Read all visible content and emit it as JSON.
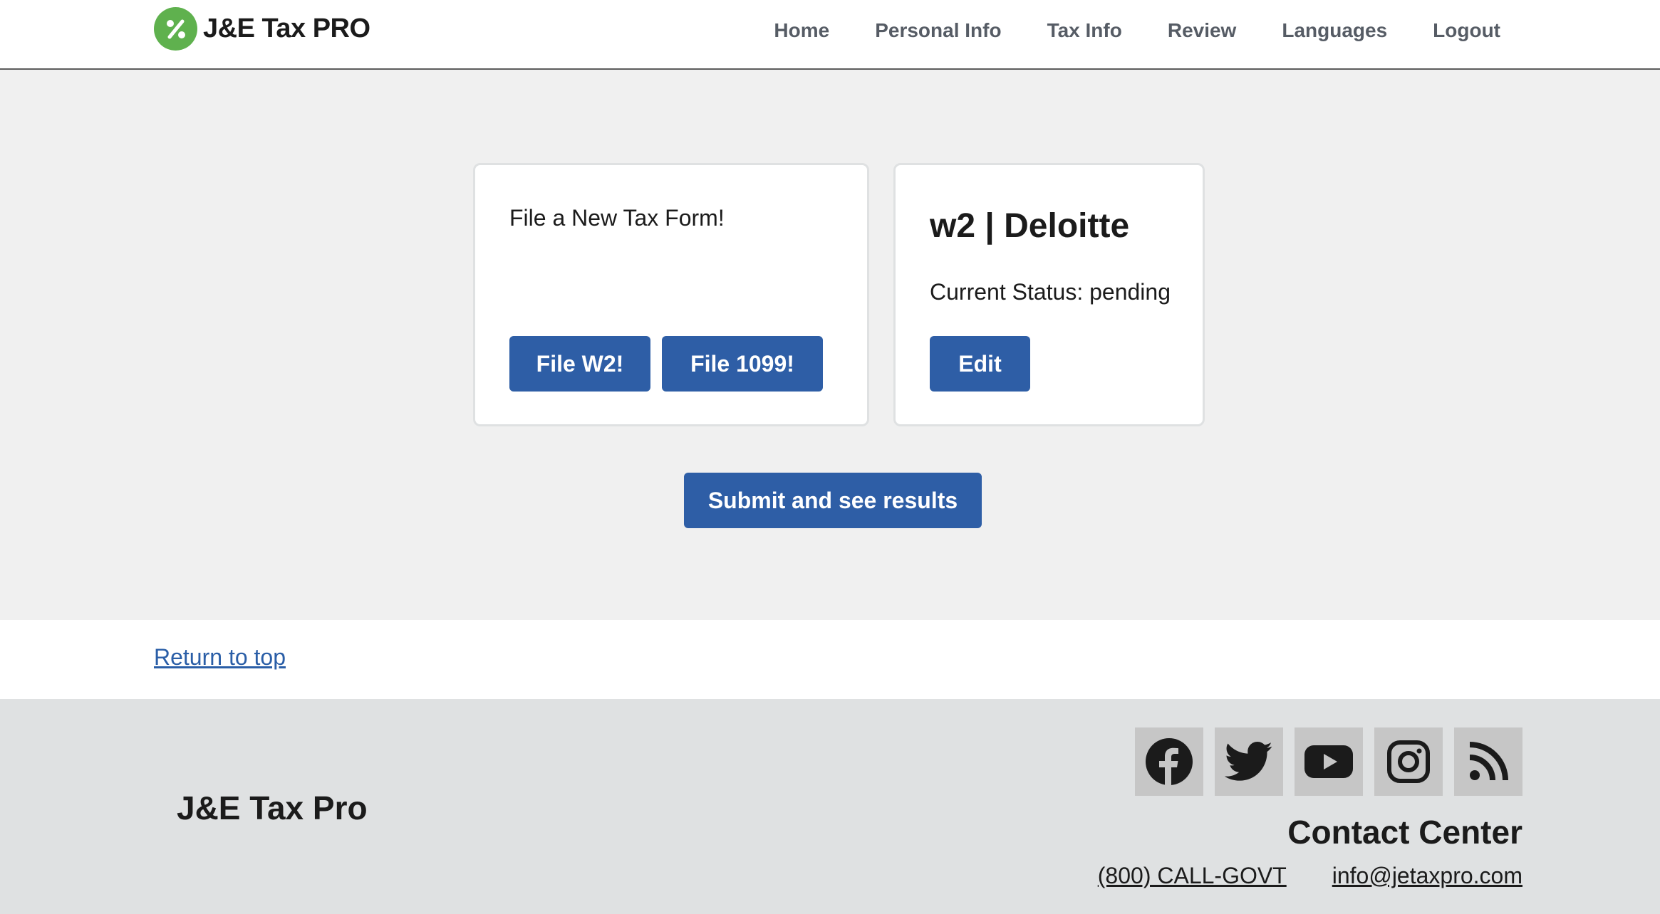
{
  "header": {
    "brand_name": "J&E Tax PRO",
    "logo_icon": "percent-icon",
    "nav": [
      {
        "label": "Home"
      },
      {
        "label": "Personal Info"
      },
      {
        "label": "Tax Info"
      },
      {
        "label": "Review"
      },
      {
        "label": "Languages"
      },
      {
        "label": "Logout"
      }
    ]
  },
  "main": {
    "new_form_card": {
      "text": "File a New Tax Form!",
      "file_w2_label": "File W2!",
      "file_1099_label": "File 1099!"
    },
    "w2_card": {
      "title": "w2 | Deloitte",
      "status_text": "Current Status: pending",
      "edit_label": "Edit"
    },
    "submit_label": "Submit and see results"
  },
  "return_to_top": "Return to top",
  "footer": {
    "brand": "J&E Tax Pro",
    "social_icons": [
      "facebook-icon",
      "twitter-icon",
      "youtube-icon",
      "instagram-icon",
      "rss-icon"
    ],
    "contact_heading": "Contact Center",
    "phone": "(800) CALL-GOVT",
    "email": "info@jetaxpro.com"
  },
  "colors": {
    "primary_button": "#2e5ea6",
    "logo_green": "#5fb14e",
    "link": "#2a5ea7",
    "main_bg": "#f0f0f0",
    "footer_bg": "#dfe1e2",
    "nav_text": "#565c65"
  }
}
